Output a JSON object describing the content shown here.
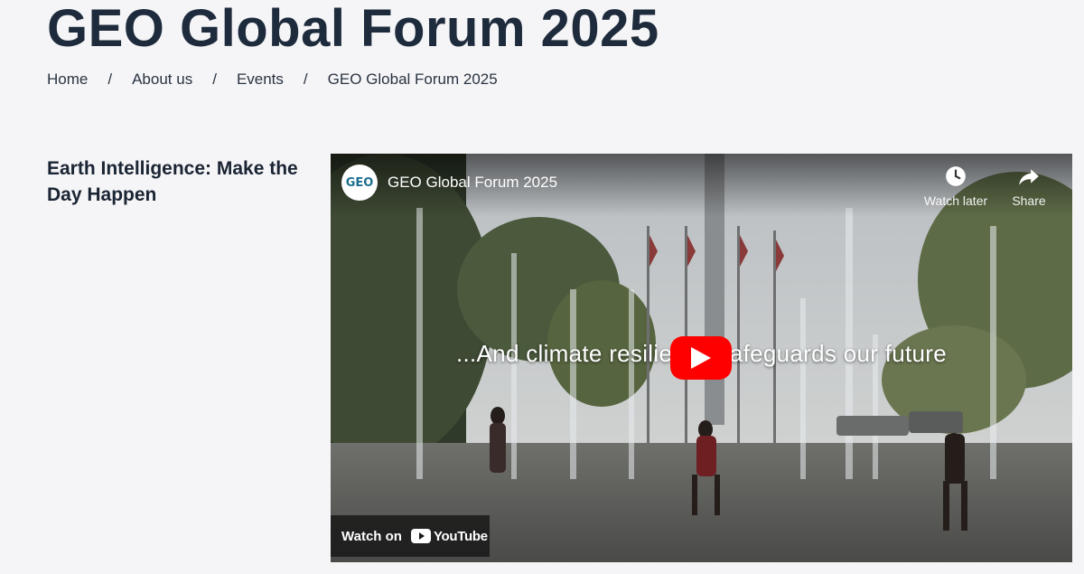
{
  "page": {
    "title": "GEO Global Forum 2025",
    "subtitle": "Earth Intelligence: Make the Day Happen"
  },
  "breadcrumb": {
    "items": [
      "Home",
      "About us",
      "Events",
      "GEO Global Forum 2025"
    ],
    "separator": "/"
  },
  "video": {
    "channel_logo_text": "GEO",
    "title": "GEO Global Forum 2025",
    "watch_later_label": "Watch later",
    "share_label": "Share",
    "caption": "...And climate resilience safeguards our future",
    "watch_on_label": "Watch on",
    "youtube_label": "YouTube",
    "icons": [
      "clock-icon",
      "share-icon",
      "play-icon",
      "youtube-logo-icon"
    ],
    "colors": {
      "play_button": "#ff0000",
      "overlay": "#191919"
    }
  }
}
